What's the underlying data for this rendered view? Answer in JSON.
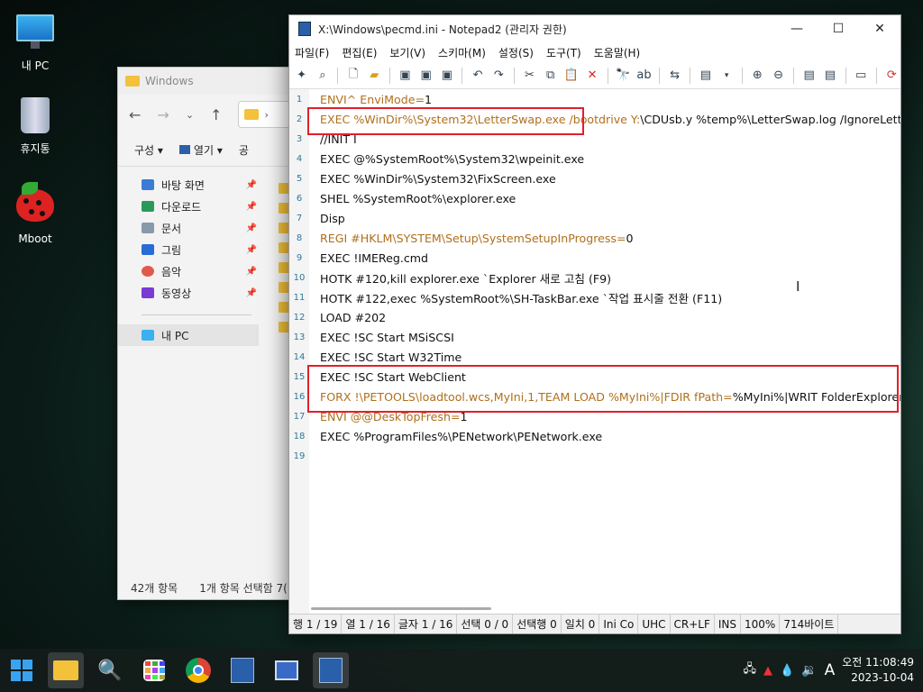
{
  "desktop": {
    "icons": [
      {
        "label": "내 PC"
      },
      {
        "label": "휴지통"
      },
      {
        "label": "Mboot"
      }
    ]
  },
  "explorer": {
    "title": "Windows",
    "address": "›",
    "commands": {
      "organize": "구성 ▾",
      "open": "열기 ▾",
      "share": "공"
    },
    "sidebar": [
      {
        "label": "바탕 화면",
        "color": "#3a7bd5"
      },
      {
        "label": "다운로드",
        "color": "#2a9a5a"
      },
      {
        "label": "문서",
        "color": "#8899aa"
      },
      {
        "label": "그림",
        "color": "#2a6ad5"
      },
      {
        "label": "음악",
        "color": "#e05a4a"
      },
      {
        "label": "동영상",
        "color": "#7a3ad5"
      }
    ],
    "this_pc": "내 PC",
    "status": {
      "count": "42개 항목",
      "selected": "1개 항목 선택함 7("
    }
  },
  "notepad": {
    "title": "X:\\Windows\\pecmd.ini - Notepad2 (관리자 권한)",
    "menu": [
      "파일(F)",
      "편집(E)",
      "보기(V)",
      "스키마(M)",
      "설정(S)",
      "도구(T)",
      "도움말(H)"
    ],
    "lines": [
      {
        "n": "1",
        "segs": [
          {
            "t": "ENVI^ EnviMode=",
            "c": "brown"
          },
          {
            "t": "1",
            "c": "black"
          }
        ]
      },
      {
        "n": "2",
        "segs": [
          {
            "t": "EXEC %WinDir%\\System32\\LetterSwap.exe /bootdrive Y:",
            "c": "brown"
          },
          {
            "t": "\\CDUsb.y %temp%\\LetterSwap.log /IgnoreLetter",
            "c": "black"
          }
        ]
      },
      {
        "n": "3",
        "segs": [
          {
            "t": "//INIT I",
            "c": "black"
          }
        ]
      },
      {
        "n": "4",
        "segs": [
          {
            "t": "EXEC @%SystemRoot%\\System32\\wpeinit.exe",
            "c": "black"
          }
        ]
      },
      {
        "n": "5",
        "segs": [
          {
            "t": "EXEC %WinDir%\\System32\\FixScreen.exe",
            "c": "black"
          }
        ]
      },
      {
        "n": "6",
        "segs": [
          {
            "t": "SHEL %SystemRoot%\\explorer.exe",
            "c": "black"
          }
        ]
      },
      {
        "n": "7",
        "segs": [
          {
            "t": "Disp",
            "c": "black"
          }
        ]
      },
      {
        "n": "8",
        "segs": [
          {
            "t": "REGI #HKLM\\SYSTEM\\Setup\\SystemSetupInProgress=",
            "c": "brown"
          },
          {
            "t": "0",
            "c": "black"
          }
        ]
      },
      {
        "n": "9",
        "segs": [
          {
            "t": "EXEC !IMEReg.cmd",
            "c": "black"
          }
        ]
      },
      {
        "n": "10",
        "segs": [
          {
            "t": "HOTK #120,kill explorer.exe `Explorer 새로 고침 (F9)",
            "c": "black"
          }
        ]
      },
      {
        "n": "11",
        "segs": [
          {
            "t": "HOTK #122,exec %SystemRoot%\\SH-TaskBar.exe `작업 표시줄 전환 (F11)",
            "c": "black"
          }
        ]
      },
      {
        "n": "12",
        "segs": [
          {
            "t": "LOAD #202",
            "c": "black"
          }
        ]
      },
      {
        "n": "13",
        "segs": [
          {
            "t": "EXEC !SC Start MSiSCSI",
            "c": "black"
          }
        ]
      },
      {
        "n": "14",
        "segs": [
          {
            "t": "EXEC !SC Start W32Time",
            "c": "black"
          }
        ]
      },
      {
        "n": "15",
        "segs": [
          {
            "t": "EXEC !SC Start WebClient",
            "c": "black"
          }
        ]
      },
      {
        "n": "16",
        "segs": [
          {
            "t": "FORX !\\PETOOLS\\loadtool.wcs,MyIni,1,TEAM LOAD %MyIni%|FDIR fPath=",
            "c": "brown"
          },
          {
            "t": "%MyIni%|WRIT FolderExplorer.i",
            "c": "black"
          }
        ]
      },
      {
        "n": "17",
        "segs": [
          {
            "t": "ENVI @@DeskTopFresh=",
            "c": "brown"
          },
          {
            "t": "1",
            "c": "black"
          }
        ]
      },
      {
        "n": "18",
        "segs": [
          {
            "t": "EXEC %ProgramFiles%\\PENetwork\\PENetwork.exe",
            "c": "black"
          }
        ]
      },
      {
        "n": "19",
        "segs": []
      }
    ],
    "status": [
      "행 1 / 19",
      "열 1 / 16",
      "글자 1 / 16",
      "선택 0 / 0",
      "선택행 0",
      "일치 0",
      "Ini Co",
      "UHC",
      "CR+LF",
      "INS",
      "100%",
      "714바이트"
    ]
  },
  "taskbar": {
    "time": "오전 11:08:49",
    "date": "2023-10-04",
    "ime": "A"
  }
}
